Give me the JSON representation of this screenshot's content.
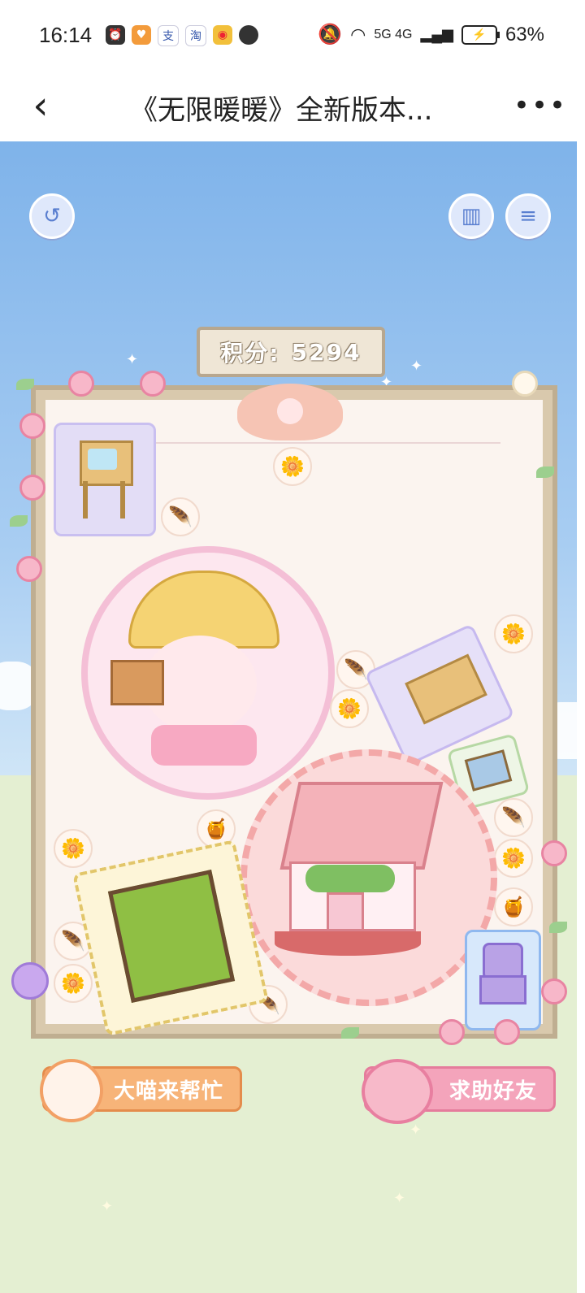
{
  "status_bar": {
    "time": "16:14",
    "network": "5G 4G",
    "battery": "63%"
  },
  "header": {
    "back_icon": "‹",
    "title": "《无限暖暖》全新版本...",
    "more_icon": "•••"
  },
  "game": {
    "score_label": "积分:",
    "score_value": "5294",
    "buttons": {
      "back": "↺",
      "ranking": "▥",
      "list": "≡"
    },
    "help_buttons": {
      "cat_help": "大喵来帮忙",
      "friend_help": "求助好友"
    },
    "colors": {
      "sky": "#7fb3ea",
      "grass": "#e4efd2",
      "frame": "#bfae91",
      "board": "#fbf4ef",
      "cat_button": "#f5a86a",
      "friend_button": "#f09ab3"
    }
  }
}
